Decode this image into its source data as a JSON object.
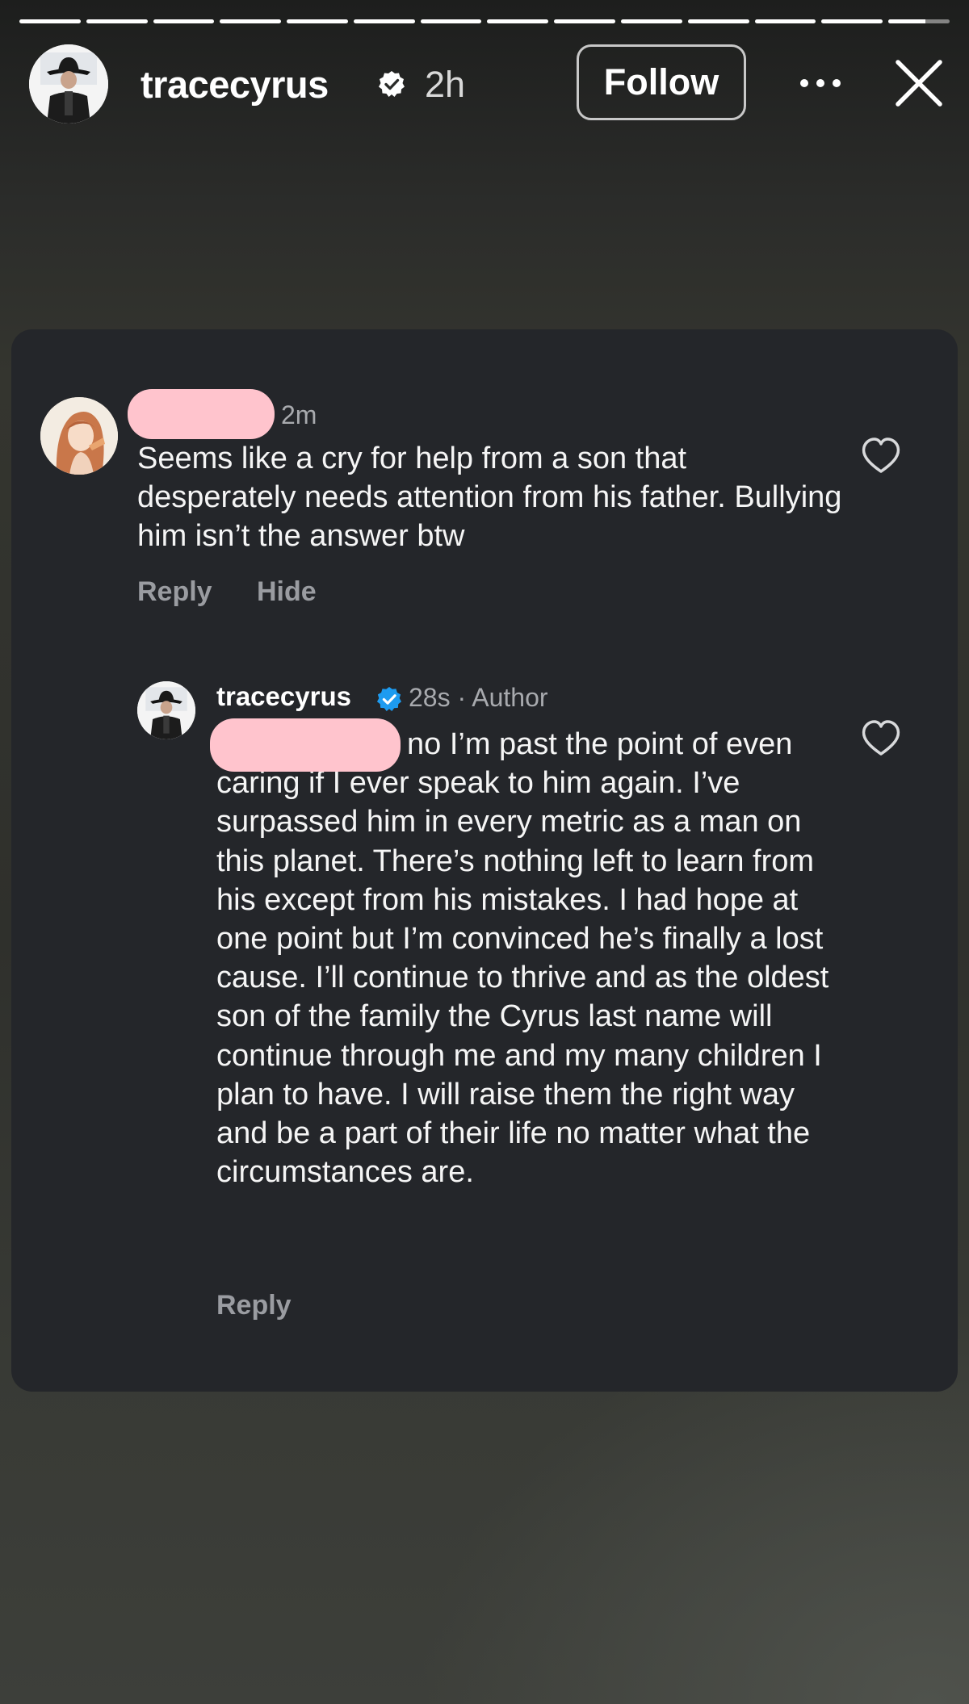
{
  "story": {
    "progress": [
      1,
      1,
      1,
      1,
      1,
      1,
      1,
      1,
      1,
      1,
      1,
      1,
      1,
      0.6
    ]
  },
  "header": {
    "username": "tracecyrus",
    "verified_icon": "verified-badge-icon",
    "time": "2h",
    "follow_label": "Follow",
    "more_icon": "more-horizontal-icon",
    "close_icon": "close-icon"
  },
  "comments": [
    {
      "avatar_icon": "anime-avatar",
      "username_redacted": true,
      "time": "2m",
      "text": "Seems like a cry for help from a son that desperately needs attention from his father. Bullying him isn’t the answer btw",
      "reply_label": "Reply",
      "hide_label": "Hide",
      "like_icon": "heart-icon"
    },
    {
      "avatar_icon": "cowboy-avatar",
      "username": "tracecyrus",
      "verified_icon": "verified-badge-icon",
      "meta": "28s · Author",
      "mention_redacted": true,
      "text": "no I’m past the point of even caring if I ever speak to him again. I’ve surpassed him in every metric as a man on this planet. There’s nothing left to learn from his except from his mistakes. I had hope at one point but I’m convinced he’s finally a lost cause. I’ll continue to thrive and as the oldest son of the family the Cyrus last name will continue through me and my many children I plan to have. I will raise them the right way and be a part of their life no matter what the circumstances are.",
      "reply_label": "Reply",
      "like_icon": "heart-icon"
    }
  ],
  "colors": {
    "card": "#24262a",
    "redaction": "#ffc4cd",
    "verified": "#1d9bf0",
    "secondary_text": "#a8aaae"
  }
}
